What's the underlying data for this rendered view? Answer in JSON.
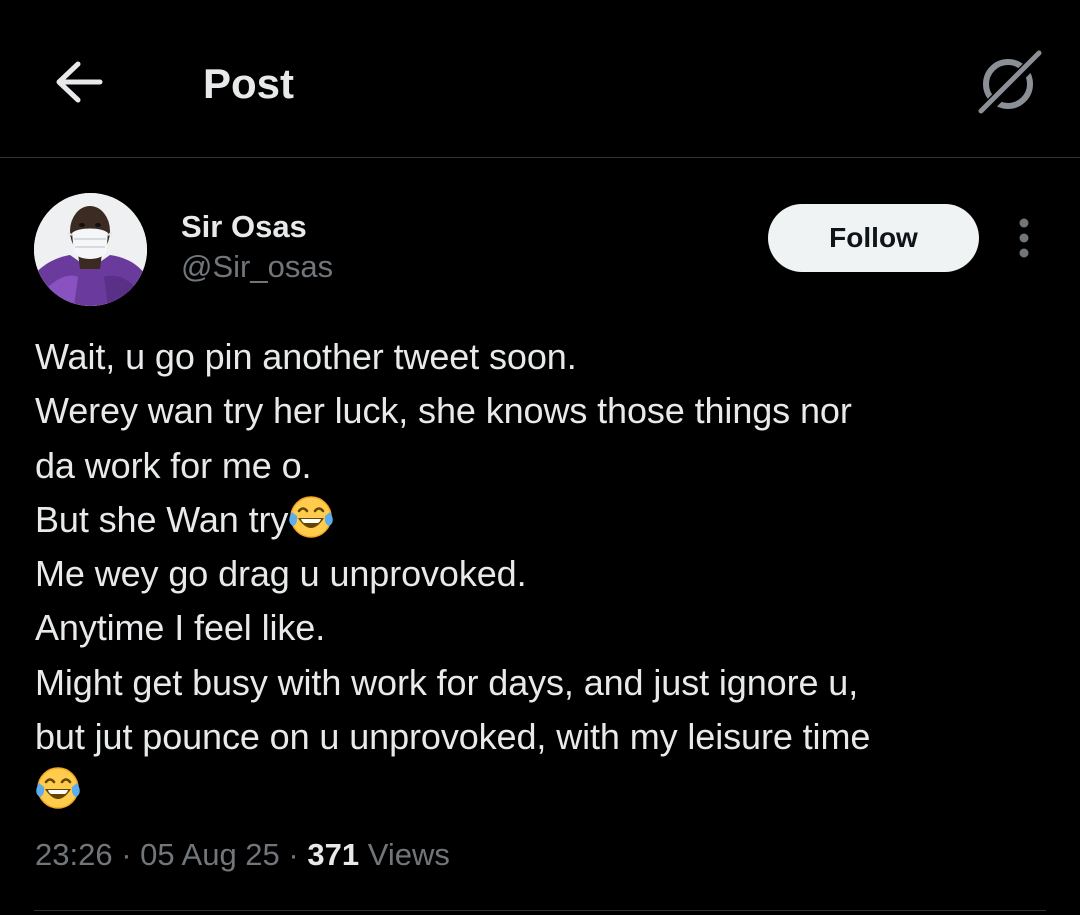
{
  "header": {
    "title": "Post",
    "back_icon": "arrow-left-icon",
    "grok_icon": "grok-icon"
  },
  "author": {
    "name": "Sir Osas",
    "handle": "@Sir_osas",
    "avatar": "avatar-photo"
  },
  "actions": {
    "follow_label": "Follow",
    "more_icon": "more-vertical-icon"
  },
  "post": {
    "lines": [
      "Wait, u go pin another tweet soon.",
      "Werey wan try her luck, she knows those things nor",
      "da work for me o.",
      "But she Wan try",
      "Me wey go drag u unprovoked.",
      "Anytime I feel like.",
      "Might get busy with work for days, and just ignore u,",
      "but jut pounce on u unprovoked, with my leisure time",
      ""
    ],
    "emoji_name": "face-with-tears-of-joy-emoji"
  },
  "meta": {
    "time": "23:26",
    "separator": "·",
    "date": "05 Aug 25",
    "views_count": "371",
    "views_label": "Views"
  },
  "colors": {
    "background": "#000000",
    "text_primary": "#e7e9ea",
    "text_secondary": "#71767b",
    "divider": "#2f3336",
    "follow_bg": "#eff3f4",
    "follow_text": "#0f1419"
  }
}
